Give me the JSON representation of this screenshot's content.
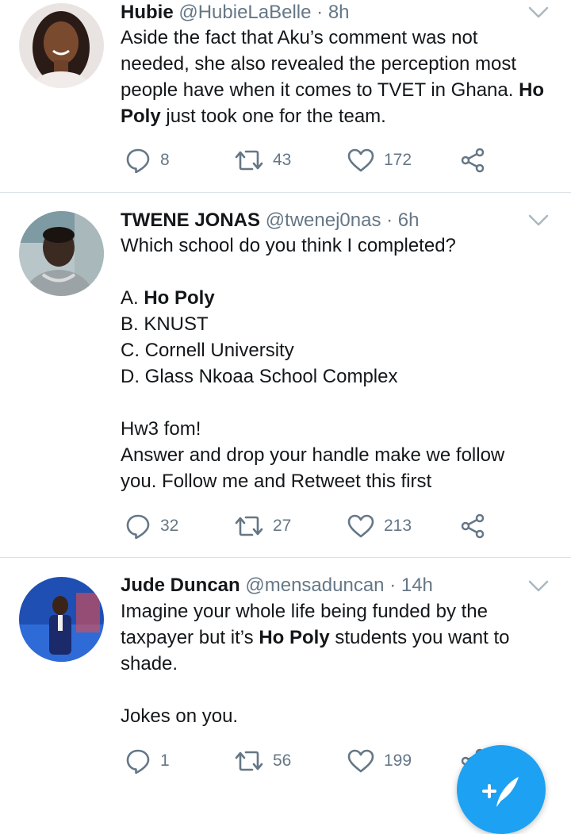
{
  "colors": {
    "accent": "#1da1f2",
    "text": "#14171a",
    "muted": "#657786",
    "divider": "#dbe1e6"
  },
  "tweets": [
    {
      "name": "Hubie",
      "handle": "@HubieLaBelle",
      "time": "· 8h",
      "lines": [
        [
          {
            "t": "Aside the fact that Aku’s comment was not"
          }
        ],
        [
          {
            "t": "needed, she also revealed the perception most"
          }
        ],
        [
          {
            "t": "people have when it comes to TVET in Ghana. "
          },
          {
            "t": "Ho",
            "b": true
          }
        ],
        [
          {
            "t": "Poly",
            "b": true
          },
          {
            "t": " just took one for the team."
          }
        ]
      ],
      "replies": "8",
      "retweets": "43",
      "likes": "172"
    },
    {
      "name": "TWENE JONAS",
      "handle": "@twenej0nas",
      "time": "· 6h",
      "lines": [
        [
          {
            "t": "Which school do you think I completed?"
          }
        ],
        [],
        [
          {
            "t": "A. "
          },
          {
            "t": "Ho Poly",
            "b": true
          }
        ],
        [
          {
            "t": "B. KNUST"
          }
        ],
        [
          {
            "t": "C. Cornell University"
          }
        ],
        [
          {
            "t": "D. Glass Nkoaa School Complex"
          }
        ],
        [],
        [
          {
            "t": "Hw3 fom!"
          }
        ],
        [
          {
            "t": "Answer and drop your handle make we follow"
          }
        ],
        [
          {
            "t": "you. Follow me and Retweet this first"
          }
        ]
      ],
      "replies": "32",
      "retweets": "27",
      "likes": "213"
    },
    {
      "name": "Jude Duncan",
      "handle": "@mensaduncan",
      "time": "· 14h",
      "lines": [
        [
          {
            "t": "Imagine your whole life being funded by the"
          }
        ],
        [
          {
            "t": "taxpayer but it’s "
          },
          {
            "t": "Ho Poly",
            "b": true
          },
          {
            "t": " students you want to"
          }
        ],
        [
          {
            "t": "shade."
          }
        ],
        [],
        [
          {
            "t": "Jokes on you."
          }
        ]
      ],
      "replies": "1",
      "retweets": "56",
      "likes": "199"
    }
  ],
  "icons": {
    "reply": "reply-icon",
    "retweet": "retweet-icon",
    "like": "heart-icon",
    "share": "share-icon",
    "menu": "chevron-down-icon",
    "compose": "compose-tweet-icon"
  }
}
